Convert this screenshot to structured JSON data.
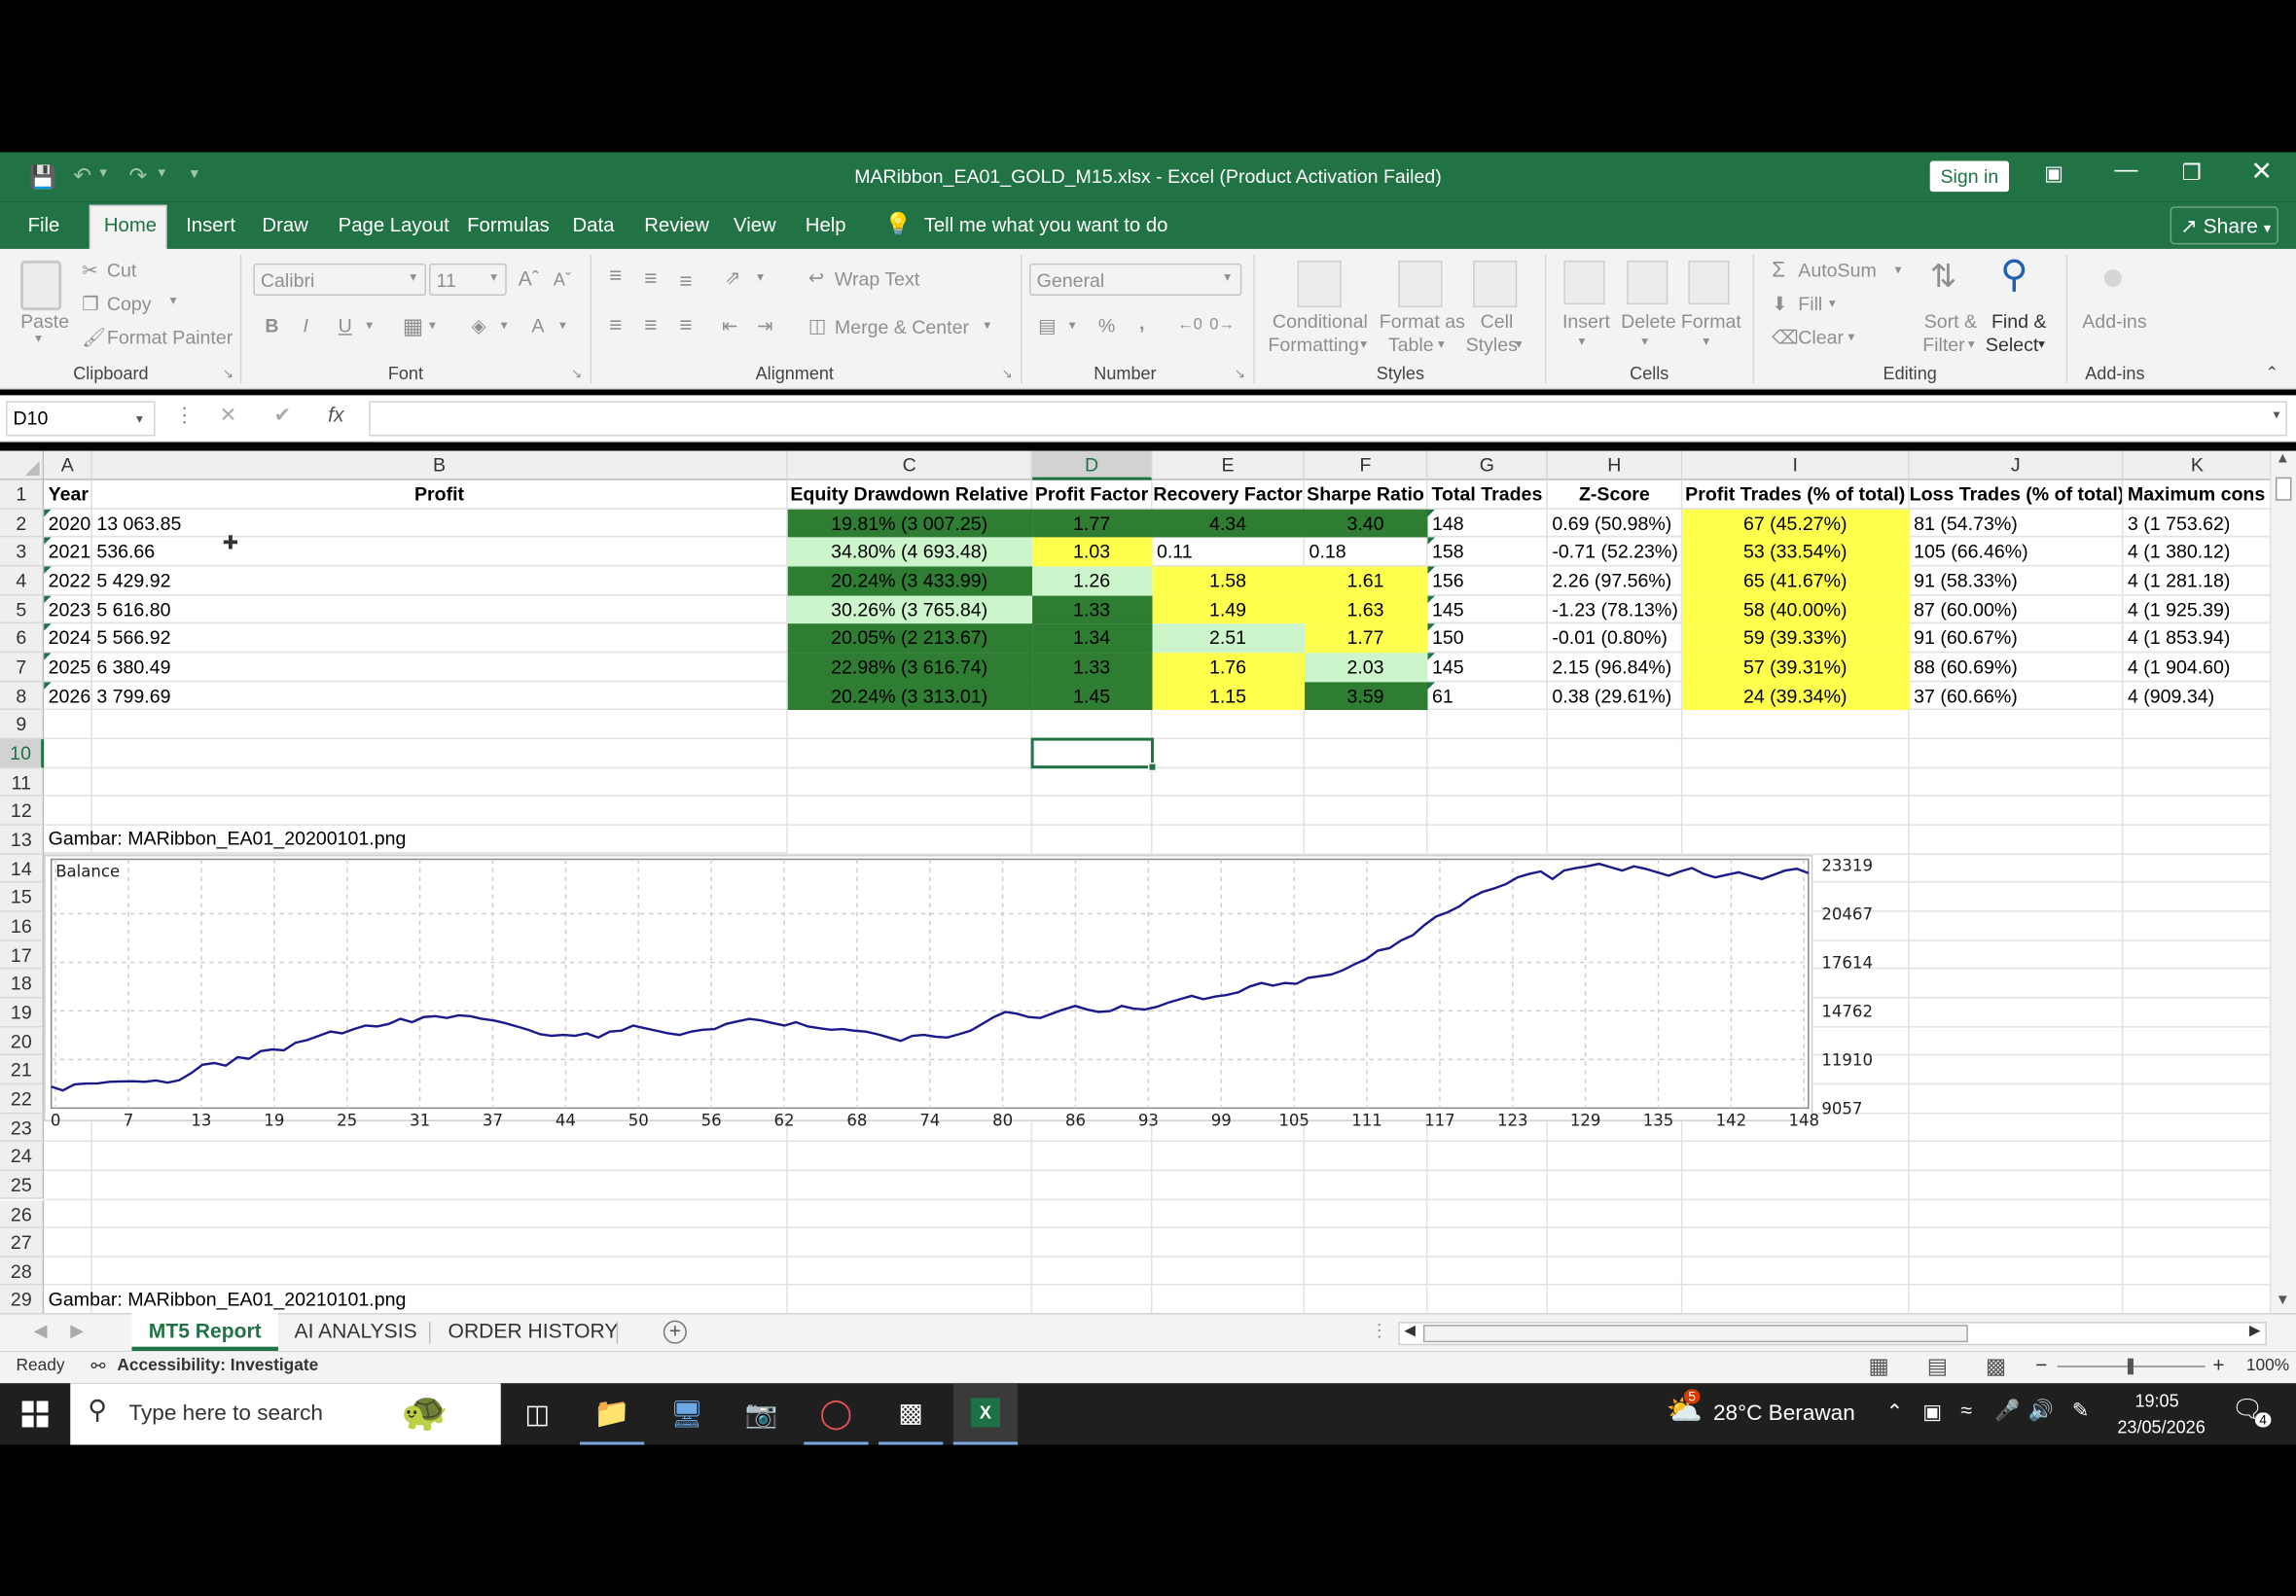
{
  "colors": {
    "excel_green": "#217346",
    "dark_green": "#2e7d32",
    "light_green": "#ccf5cc",
    "yellow": "#ffff4d",
    "grid": "#e2e2e2",
    "chart_line": "#1a1a8c"
  },
  "window": {
    "title": "MARibbon_EA01_GOLD_M15.xlsx  -  Excel (Product Activation Failed)",
    "sign_in": "Sign in",
    "save_icon": "save-icon",
    "undo_icon": "undo-icon",
    "redo_icon": "redo-icon"
  },
  "menu": {
    "tabs": [
      "File",
      "Home",
      "Insert",
      "Draw",
      "Page Layout",
      "Formulas",
      "Data",
      "Review",
      "View",
      "Help"
    ],
    "tell_me": "Tell me what you want to do",
    "share": "Share"
  },
  "ribbon": {
    "clipboard": {
      "paste": "Paste",
      "cut": "Cut",
      "copy": "Copy",
      "format_painter": "Format Painter",
      "label": "Clipboard"
    },
    "font": {
      "name": "Calibri",
      "size": "11",
      "bold": "B",
      "italic": "I",
      "underline": "U",
      "label": "Font"
    },
    "alignment": {
      "wrap": "Wrap Text",
      "merge": "Merge & Center",
      "label": "Alignment"
    },
    "number": {
      "format": "General",
      "percent": "%",
      "comma": ",",
      "label": "Number"
    },
    "styles": {
      "conditional": "Conditional",
      "conditional2": "Formatting",
      "format_table": "Format as",
      "format_table2": "Table",
      "cell_styles": "Cell",
      "cell_styles2": "Styles",
      "label": "Styles"
    },
    "cells": {
      "insert": "Insert",
      "delete": "Delete",
      "format": "Format",
      "label": "Cells"
    },
    "editing": {
      "autosum": "AutoSum",
      "fill": "Fill",
      "clear": "Clear",
      "sort": "Sort &",
      "sort2": "Filter",
      "find": "Find &",
      "find2": "Select",
      "label": "Editing"
    },
    "addins": {
      "addins": "Add-ins",
      "label": "Add-ins"
    }
  },
  "formula_bar": {
    "name_box": "D10",
    "fx": "fx",
    "cancel": "✕",
    "enter": "✔",
    "value": ""
  },
  "columns": [
    "A",
    "B",
    "C",
    "D",
    "E",
    "F",
    "G",
    "H",
    "I",
    "J",
    "K"
  ],
  "rows": [
    "1",
    "2",
    "3",
    "4",
    "5",
    "6",
    "7",
    "8",
    "9",
    "10",
    "11",
    "12",
    "13",
    "14",
    "15",
    "16",
    "17",
    "18",
    "19",
    "20",
    "21",
    "22",
    "23",
    "24",
    "25",
    "26",
    "27",
    "28",
    "29"
  ],
  "headers": {
    "year": "Year",
    "profit": "Profit",
    "c": "Equity Drawdown Relative",
    "d": "Profit Factor",
    "e": "Recovery Factor",
    "f": "Sharpe Ratio",
    "g": "Total Trades",
    "h": "Z-Score",
    "i": "Profit Trades (% of total)",
    "j": "Loss Trades (% of total)",
    "k": "Maximum cons"
  },
  "table": [
    {
      "year": "2020",
      "profit": "13 063.85",
      "c": "19.81% (3 007.25)",
      "d": "1.77",
      "e": "4.34",
      "f": "3.40",
      "g": "148",
      "h": "0.69 (50.98%)",
      "i": "67 (45.27%)",
      "j": "81 (54.73%)",
      "k": "3 (1 753.62)"
    },
    {
      "year": "2021",
      "profit": "536.66",
      "c": "34.80% (4 693.48)",
      "d": "1.03",
      "e": "0.11",
      "f": "0.18",
      "g": "158",
      "h": "-0.71 (52.23%)",
      "i": "53 (33.54%)",
      "j": "105 (66.46%)",
      "k": "4 (1 380.12)"
    },
    {
      "year": "2022",
      "profit": "5 429.92",
      "c": "20.24% (3 433.99)",
      "d": "1.26",
      "e": "1.58",
      "f": "1.61",
      "g": "156",
      "h": "2.26 (97.56%)",
      "i": "65 (41.67%)",
      "j": "91 (58.33%)",
      "k": "4 (1 281.18)"
    },
    {
      "year": "2023",
      "profit": "5 616.80",
      "c": "30.26% (3 765.84)",
      "d": "1.33",
      "e": "1.49",
      "f": "1.63",
      "g": "145",
      "h": "-1.23 (78.13%)",
      "i": "58 (40.00%)",
      "j": "87 (60.00%)",
      "k": "4 (1 925.39)"
    },
    {
      "year": "2024",
      "profit": "5 566.92",
      "c": "20.05% (2 213.67)",
      "d": "1.34",
      "e": "2.51",
      "f": "1.77",
      "g": "150",
      "h": "-0.01 (0.80%)",
      "i": "59 (39.33%)",
      "j": "91 (60.67%)",
      "k": "4 (1 853.94)"
    },
    {
      "year": "2025",
      "profit": "6 380.49",
      "c": "22.98% (3 616.74)",
      "d": "1.33",
      "e": "1.76",
      "f": "2.03",
      "g": "145",
      "h": "2.15 (96.84%)",
      "i": "57 (39.31%)",
      "j": "88 (60.69%)",
      "k": "4 (1 904.60)"
    },
    {
      "year": "2026",
      "profit": "3 799.69",
      "c": "20.24% (3 313.01)",
      "d": "1.45",
      "e": "1.15",
      "f": "3.59",
      "g": "61",
      "h": "0.38 (29.61%)",
      "i": "24 (39.34%)",
      "j": "37 (60.66%)",
      "k": "4 (909.34)"
    }
  ],
  "labels": {
    "a13": "Gambar: MARibbon_EA01_20200101.png",
    "a29": "Gambar: MARibbon_EA01_20210101.png"
  },
  "chart_data": {
    "type": "line",
    "title": "Balance",
    "x_ticks": [
      "0",
      "7",
      "13",
      "19",
      "25",
      "31",
      "37",
      "44",
      "50",
      "56",
      "62",
      "68",
      "74",
      "80",
      "86",
      "93",
      "99",
      "105",
      "111",
      "117",
      "123",
      "129",
      "135",
      "142",
      "148"
    ],
    "y_ticks": [
      "23319",
      "20467",
      "17614",
      "14762",
      "11910",
      "9057"
    ],
    "ylim": [
      9057,
      23319
    ],
    "xlim": [
      0,
      151
    ],
    "grid": true,
    "series": [
      {
        "values": [
          10320,
          10100,
          10450,
          10500,
          10510,
          10600,
          10620,
          10640,
          10600,
          10680,
          10550,
          10700,
          11100,
          11600,
          11700,
          11550,
          12050,
          11950,
          12400,
          12500,
          12450,
          12900,
          13050,
          13300,
          13550,
          13450,
          13700,
          13900,
          13850,
          14000,
          14300,
          14100,
          14400,
          14450,
          14350,
          14500,
          14450,
          14300,
          14200,
          14050,
          13850,
          13650,
          13400,
          13300,
          13350,
          13300,
          13450,
          13200,
          13550,
          13600,
          13900,
          13750,
          13600,
          13450,
          13350,
          13550,
          13650,
          13700,
          14000,
          14150,
          14300,
          14200,
          14050,
          13900,
          14100,
          13850,
          13750,
          13650,
          13700,
          13600,
          13550,
          13400,
          13200,
          13000,
          13300,
          13350,
          13250,
          13200,
          13400,
          13600,
          14000,
          14400,
          14700,
          14600,
          14400,
          14350,
          14600,
          14850,
          15050,
          14850,
          14700,
          14750,
          15050,
          14900,
          14850,
          15000,
          15250,
          15450,
          15650,
          15450,
          15600,
          15700,
          15850,
          16200,
          16400,
          16250,
          16400,
          16350,
          16700,
          16800,
          16900,
          17150,
          17500,
          17800,
          18300,
          18450,
          18900,
          19200,
          19800,
          20300,
          20550,
          20900,
          21400,
          21750,
          21950,
          22200,
          22600,
          22800,
          22950,
          22500,
          23000,
          23150,
          23250,
          23400,
          23200,
          23000,
          23250,
          23100,
          22900,
          22700,
          22950,
          23150,
          22800,
          22600,
          22750,
          22900,
          22700,
          22500,
          22750,
          23000,
          23100,
          22850
        ]
      }
    ]
  },
  "sheets": {
    "tab1": "MT5 Report",
    "tab2": "AI ANALYSIS",
    "tab3": "ORDER HISTORY",
    "add": "+"
  },
  "status": {
    "ready": "Ready",
    "accessibility": "Accessibility: Investigate",
    "zoom": "100%"
  },
  "taskbar": {
    "search": "Type here to search",
    "weather": "28°C  Berawan",
    "weather_badge": "5",
    "time": "19:05",
    "date": "23/05/2026",
    "notif": "4"
  }
}
